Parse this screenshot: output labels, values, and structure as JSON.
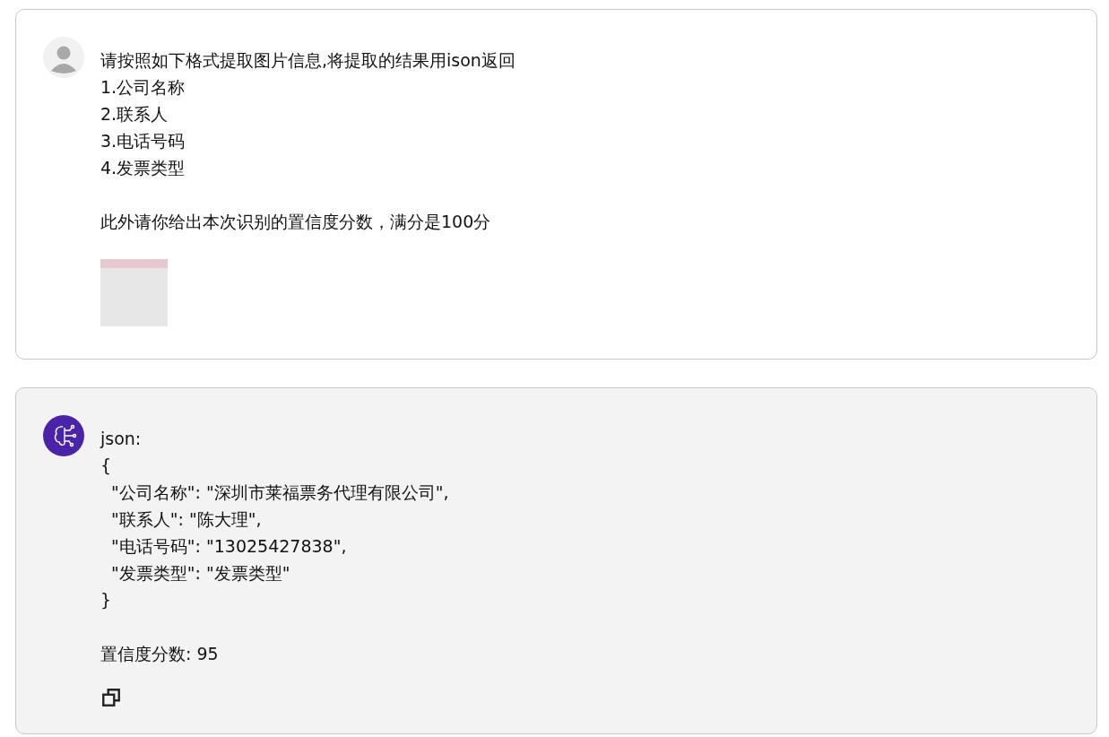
{
  "messages": [
    {
      "kind": "user",
      "paragraphs": [
        [
          "请按照如下格式提取图片信息,将提取的结果用ison返回",
          "1.公司名称",
          "2.联系人",
          "3.电话号码",
          "4.发票类型"
        ],
        [
          "此外请你给出本次识别的置信度分数，满分是100分"
        ]
      ],
      "has_image": true,
      "copy_button": false
    },
    {
      "kind": "assistant",
      "paragraphs": [
        [
          "json:",
          "{",
          "  \"公司名称\": \"深圳市莱福票务代理有限公司\",",
          "  \"联系人\": \"陈大理\",",
          "  \"电话号码\": \"13025427838\",",
          "  \"发票类型\": \"发票类型\"",
          "}"
        ],
        [
          "置信度分数: 95"
        ]
      ],
      "has_image": false,
      "copy_button": true
    }
  ]
}
